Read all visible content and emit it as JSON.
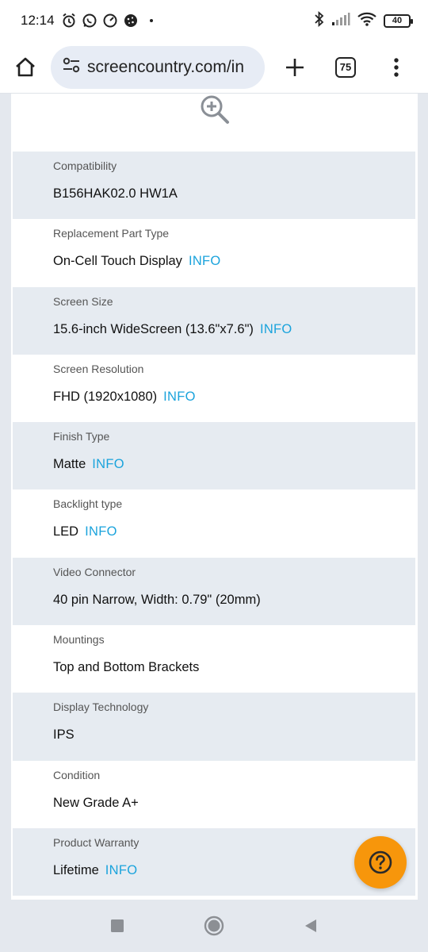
{
  "status_bar": {
    "time": "12:14",
    "battery": "40",
    "left_icons": [
      "alarm-icon",
      "whatsapp-icon",
      "speedometer-icon",
      "cookie-icon",
      "dot-icon"
    ],
    "right_icons": [
      "bluetooth-icon",
      "signal-icon",
      "wifi-icon",
      "battery-icon"
    ]
  },
  "browser": {
    "url": "screencountry.com/in",
    "tab_count": "75"
  },
  "specs": [
    {
      "label": "Compatibility",
      "value": "B156HAK02.0 HW1A",
      "info": ""
    },
    {
      "label": "Replacement Part Type",
      "value": "On-Cell Touch Display",
      "info": "INFO"
    },
    {
      "label": "Screen Size",
      "value": "15.6-inch WideScreen (13.6\"x7.6\")",
      "info": "INFO"
    },
    {
      "label": "Screen Resolution",
      "value": "FHD (1920x1080)",
      "info": "INFO"
    },
    {
      "label": "Finish Type",
      "value": "Matte",
      "info": "INFO"
    },
    {
      "label": "Backlight type",
      "value": "LED",
      "info": "INFO"
    },
    {
      "label": "Video Connector",
      "value": "40 pin Narrow, Width: 0.79\" (20mm)",
      "info": ""
    },
    {
      "label": "Mountings",
      "value": "Top and Bottom Brackets",
      "info": ""
    },
    {
      "label": "Display Technology",
      "value": "IPS",
      "info": ""
    },
    {
      "label": "Condition",
      "value": "New Grade A+",
      "info": ""
    },
    {
      "label": "Product Warranty",
      "value": "Lifetime",
      "info": "INFO"
    }
  ],
  "colors": {
    "info_link": "#1aa3dc",
    "row_shade": "#e6ebf1",
    "help_button": "#f7960b"
  }
}
